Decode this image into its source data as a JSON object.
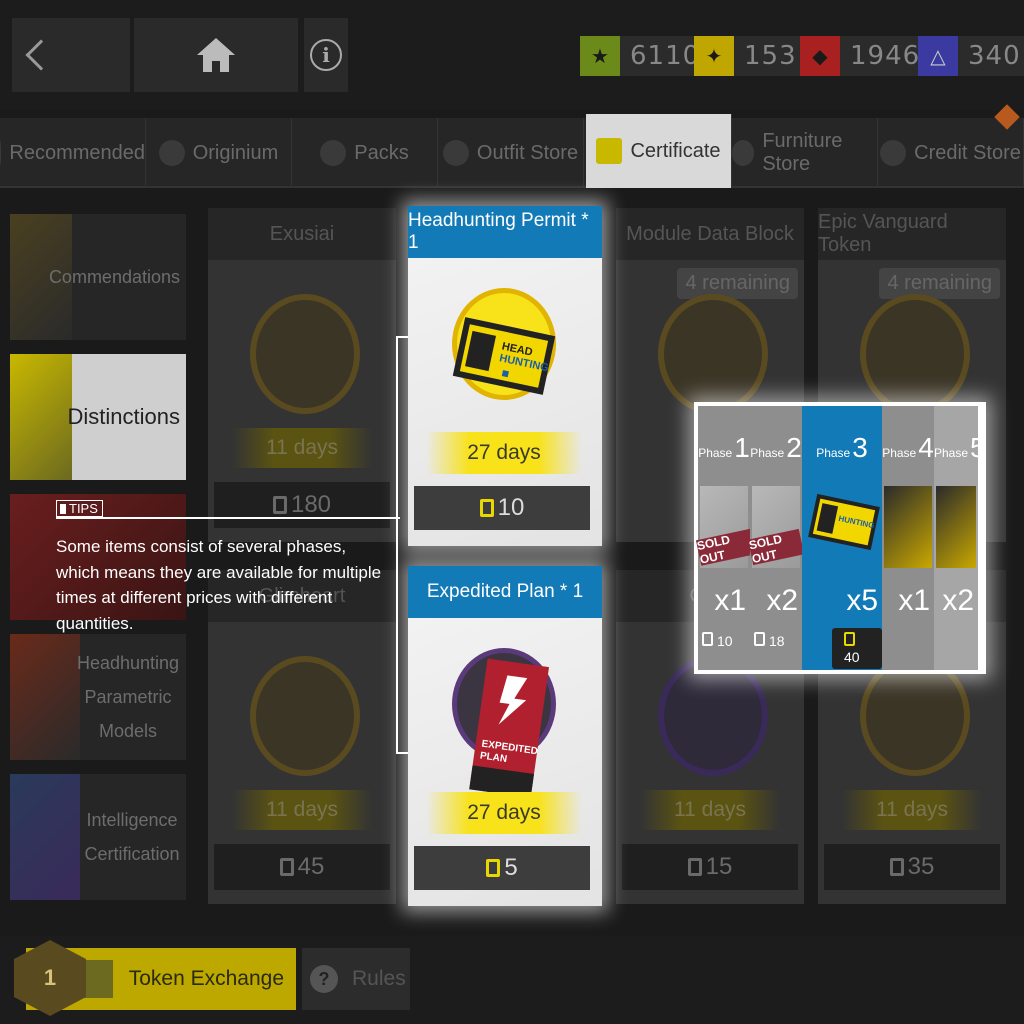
{
  "header": {
    "currencies": [
      {
        "name": "certificate-green-icon",
        "value": "6110",
        "color": "#6b8a1a"
      },
      {
        "name": "certificate-yellow-icon",
        "value": "153",
        "color": "#bfa600"
      },
      {
        "name": "certificate-red-icon",
        "value": "1946",
        "color": "#a82020"
      },
      {
        "name": "certificate-blue-icon",
        "value": "340",
        "color": "#3a3aa0"
      }
    ]
  },
  "tabs": [
    {
      "label": "Recommended"
    },
    {
      "label": "Originium"
    },
    {
      "label": "Packs"
    },
    {
      "label": "Outfit Store"
    },
    {
      "label": "Certificate"
    },
    {
      "label": "Furniture Store"
    },
    {
      "label": "Credit Store"
    }
  ],
  "sidebar": [
    {
      "label": "Commendations"
    },
    {
      "label": "Distinctions"
    },
    {
      "label": ""
    },
    {
      "label": "Headhunting Parametric Models"
    },
    {
      "label": "Intelligence Certification"
    }
  ],
  "cards": [
    {
      "title": "Exusiai",
      "days": "11 days",
      "price": "180",
      "remaining": ""
    },
    {
      "title": "Module Data Block",
      "days": "",
      "price": "",
      "remaining": "4 remaining"
    },
    {
      "title": "Epic Vanguard Token",
      "days": "",
      "price": "",
      "remaining": "4 remaining"
    },
    {
      "title": "Glimheart",
      "days": "11 days",
      "price": "45",
      "remaining": ""
    },
    {
      "title": "Chip",
      "days": "11 days",
      "price": "15",
      "remaining": ""
    },
    {
      "title": "",
      "days": "11 days",
      "price": "35",
      "remaining": ""
    }
  ],
  "highlighted": [
    {
      "title": "Headhunting Permit * 1",
      "days": "27 days",
      "price": "10"
    },
    {
      "title": "Expedited Plan * 1",
      "days": "27 days",
      "price": "5"
    }
  ],
  "tips": {
    "tag": "TIPS",
    "text": "Some items consist of several  phases, which means they are available for multiple times at different prices with different quantities."
  },
  "phases": [
    {
      "phase_word": "Phase",
      "phase_num": "1",
      "qty": "x1",
      "cost": "10",
      "status": "SOLD OUT"
    },
    {
      "phase_word": "Phase",
      "phase_num": "2",
      "qty": "x2",
      "cost": "18",
      "status": "SOLD OUT"
    },
    {
      "phase_word": "Phase",
      "phase_num": "3",
      "qty": "x5",
      "cost": "40",
      "status": ""
    },
    {
      "phase_word": "Phase",
      "phase_num": "4",
      "qty": "x1",
      "cost": "",
      "status": ""
    },
    {
      "phase_word": "Phase",
      "phase_num": "5",
      "qty": "x2",
      "cost": "",
      "status": ""
    }
  ],
  "footer": {
    "token_exchange_label": "Token Exchange",
    "token_level": "1",
    "rules_label": "Rules"
  }
}
